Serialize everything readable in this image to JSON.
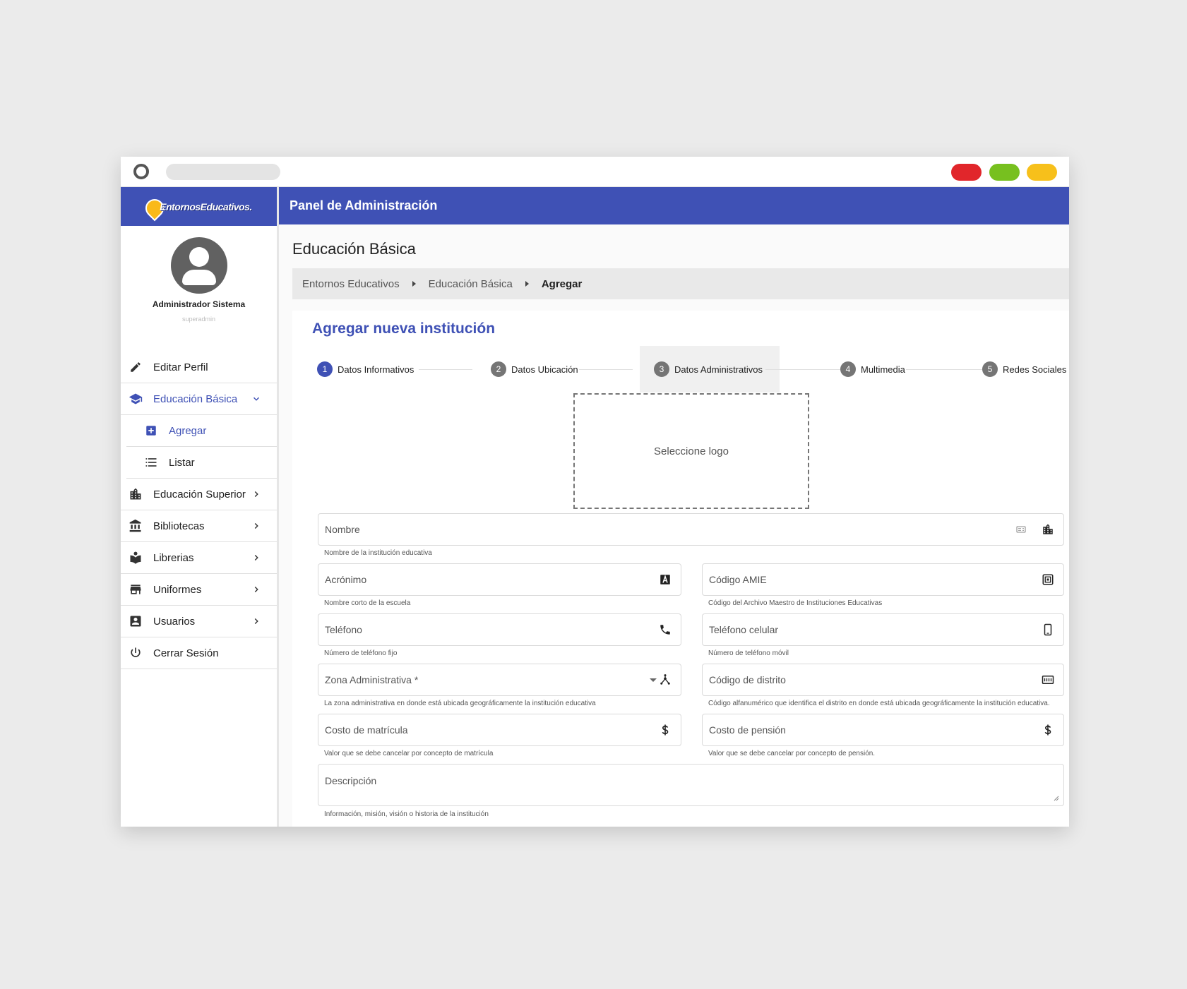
{
  "sidebar": {
    "logo_text": "EntornosEducativos.",
    "profile": {
      "name": "Administrador Sistema",
      "username": "superadmin"
    },
    "items": [
      {
        "label": "Editar Perfil"
      },
      {
        "label": "Educación Básica"
      },
      {
        "label": "Agregar"
      },
      {
        "label": "Listar"
      },
      {
        "label": "Educación Superior"
      },
      {
        "label": "Bibliotecas"
      },
      {
        "label": "Librerias"
      },
      {
        "label": "Uniformes"
      },
      {
        "label": "Usuarios"
      },
      {
        "label": "Cerrar Sesión"
      }
    ]
  },
  "header": {
    "title": "Panel de Administración"
  },
  "page": {
    "title": "Educación Básica",
    "breadcrumb": [
      "Entornos Educativos",
      "Educación Básica",
      "Agregar"
    ]
  },
  "form": {
    "title": "Agregar nueva institución",
    "steps": [
      {
        "num": "1",
        "label": "Datos Informativos"
      },
      {
        "num": "2",
        "label": "Datos Ubicación"
      },
      {
        "num": "3",
        "label": "Datos Administrativos"
      },
      {
        "num": "4",
        "label": "Multimedia"
      },
      {
        "num": "5",
        "label": "Redes Sociales"
      }
    ],
    "logo_placeholder": "Seleccione logo",
    "fields": {
      "nombre": {
        "placeholder": "Nombre",
        "hint": "Nombre de la institución educativa"
      },
      "acronimo": {
        "placeholder": "Acrónimo",
        "hint": "Nombre corto de la escuela"
      },
      "amie": {
        "placeholder": "Código AMIE",
        "hint": "Código del Archivo Maestro de Instituciones Educativas"
      },
      "telefono": {
        "placeholder": "Teléfono",
        "hint": "Número de teléfono fijo"
      },
      "celular": {
        "placeholder": "Teléfono celular",
        "hint": "Número de teléfono móvil"
      },
      "zona": {
        "placeholder": "Zona Administrativa *",
        "hint": "La zona administrativa en donde está ubicada geográficamente la institución educativa"
      },
      "distrito": {
        "placeholder": "Código de distrito",
        "hint": "Código alfanumérico que identifica el distrito en donde está ubicada geográficamente la institución educativa."
      },
      "matricula": {
        "placeholder": "Costo de matrícula",
        "hint": "Valor que se debe cancelar por concepto de matrícula"
      },
      "pension": {
        "placeholder": "Costo de pensión",
        "hint": "Valor que se debe cancelar por concepto de pensión."
      },
      "descripcion": {
        "placeholder": "Descripción",
        "hint": "Información, misión, visión o historia de la institución"
      }
    }
  },
  "colors": {
    "primary": "#3f51b5",
    "logo_accent": "#f9b91a",
    "close": "#e1262b",
    "maximize": "#77c01f",
    "minimize": "#f7c01b"
  }
}
